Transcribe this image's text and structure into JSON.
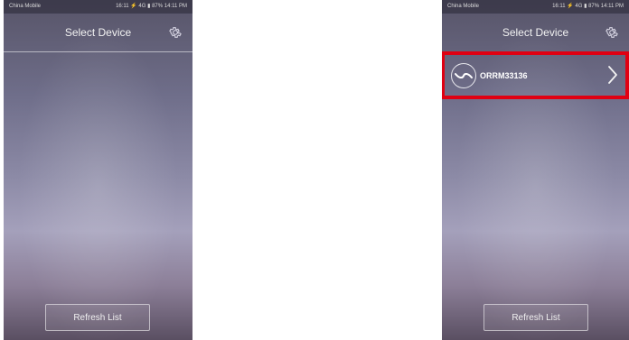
{
  "left_screen": {
    "status_left": "China Mobile",
    "status_right": "16:11 ⚡ 4G ▮ 87% 14:11 PM",
    "title": "Select Device",
    "settings_icon": "gear-icon",
    "refresh_label": "Refresh List"
  },
  "right_screen": {
    "status_left": "China Mobile",
    "status_right": "16:11 ⚡ 4G ▮ 87% 14:11 PM",
    "title": "Select Device",
    "settings_icon": "gear-icon",
    "device": {
      "name": "ORRM33136",
      "icon": "wave-icon",
      "arrow_icon": "chevron-right-icon"
    },
    "highlight_color": "#e00012",
    "refresh_label": "Refresh List"
  }
}
